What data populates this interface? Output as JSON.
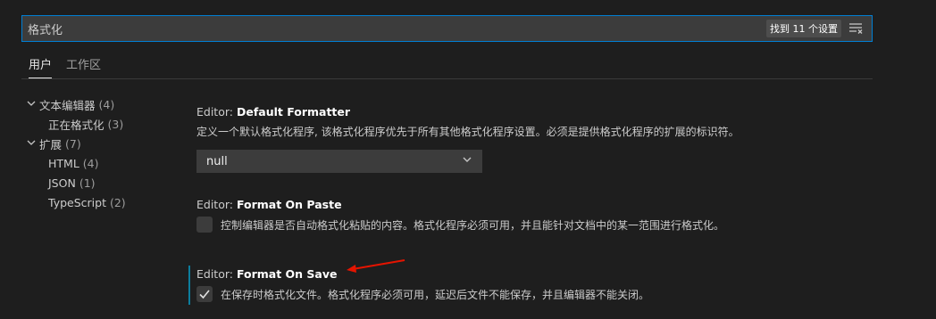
{
  "search": {
    "value": "格式化",
    "result_badge": "找到 11 个设置",
    "filter_icon": "filter-list-icon"
  },
  "tabs": [
    {
      "label": "用户",
      "active": true
    },
    {
      "label": "工作区",
      "active": false
    }
  ],
  "tree": {
    "items": [
      {
        "label": "文本编辑器",
        "count": "(4)",
        "expanded": true
      },
      {
        "label": "正在格式化",
        "count": "(3)"
      },
      {
        "label": "扩展",
        "count": "(7)",
        "expanded": true
      },
      {
        "label": "HTML",
        "count": "(4)"
      },
      {
        "label": "JSON",
        "count": "(1)"
      },
      {
        "label": "TypeScript",
        "count": "(2)"
      }
    ]
  },
  "settings": [
    {
      "category": "Editor: ",
      "name": "Default Formatter",
      "description": "定义一个默认格式化程序, 该格式化程序优先于所有其他格式化程序设置。必须是提供格式化程序的扩展的标识符。",
      "type": "dropdown",
      "value": "null"
    },
    {
      "category": "Editor: ",
      "name": "Format On Paste",
      "description": "控制编辑器是否自动格式化粘贴的内容。格式化程序必须可用，并且能针对文档中的某一范围进行格式化。",
      "type": "checkbox",
      "checked": false
    },
    {
      "category": "Editor: ",
      "name": "Format On Save",
      "description": "在保存时格式化文件。格式化程序必须可用，延迟后文件不能保存，并且编辑器不能关闭。",
      "type": "checkbox",
      "checked": true
    }
  ],
  "colors": {
    "background": "#1e1e1e",
    "input_bg": "#3c3c3c",
    "focus_border": "#007fd4",
    "modified_indicator": "#0c7d9d",
    "annotation_arrow": "#e51400"
  }
}
